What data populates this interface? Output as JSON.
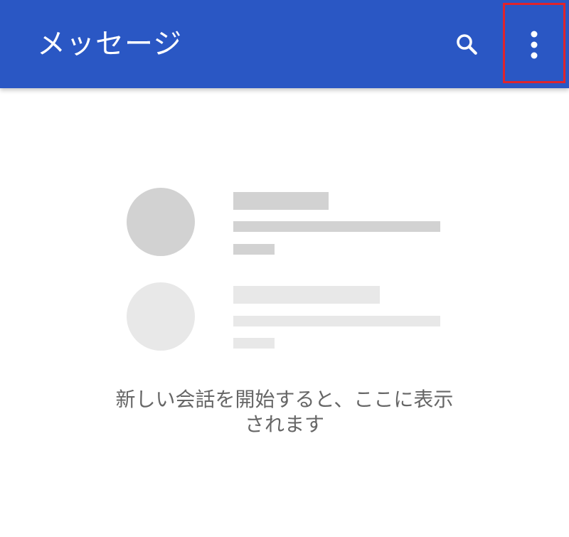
{
  "app_bar": {
    "title": "メッセージ",
    "background_color": "#2a57c4",
    "search_icon": "search-icon",
    "more_icon": "more-vertical-icon"
  },
  "highlight_color": "#e0242c",
  "empty_state": {
    "message_line1": "新しい会話を開始すると、ここに表示",
    "message_line2": "されます"
  }
}
